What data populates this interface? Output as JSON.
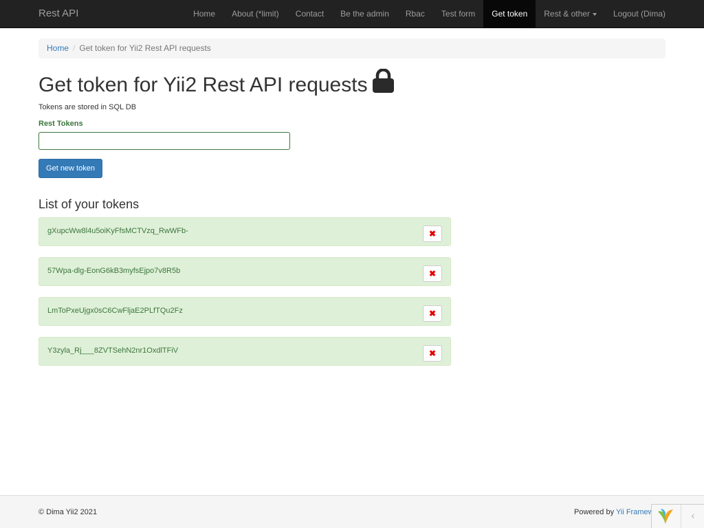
{
  "navbar": {
    "brand": "Rest API",
    "items": [
      {
        "label": "Home"
      },
      {
        "label": "About (*limit)"
      },
      {
        "label": "Contact"
      },
      {
        "label": "Be the admin"
      },
      {
        "label": "Rbac"
      },
      {
        "label": "Test form"
      },
      {
        "label": "Get token",
        "active": true
      },
      {
        "label": "Rest & other",
        "dropdown": true
      },
      {
        "label": "Logout (Dima)"
      }
    ]
  },
  "breadcrumb": {
    "home": "Home",
    "separator": "/",
    "current": "Get token for Yii2 Rest API requests"
  },
  "page": {
    "title": "Get token for Yii2 Rest API requests",
    "icon": "lock-icon",
    "subtitle": "Tokens are stored in SQL DB",
    "field_label": "Rest Tokens",
    "field_value": "",
    "button_label": "Get new token",
    "list_title": "List of your tokens"
  },
  "tokens": [
    {
      "value": "gXupcWw8l4u5oiKyFfsMCTVzq_RwWFb-",
      "delete_icon": "✖"
    },
    {
      "value": "57Wpa-dlg-EonG6kB3myfsEjpo7v8R5b",
      "delete_icon": "✖"
    },
    {
      "value": "LmToPxeUjgx0sC6CwFljaE2PLfTQu2Fz",
      "delete_icon": "✖"
    },
    {
      "value": "Y3zyla_Rj___8ZVTSehN2nr1OxdlTFiV",
      "delete_icon": "✖"
    }
  ],
  "footer": {
    "copyright": "© Dima Yii2 2021",
    "powered_prefix": "Powered by",
    "powered_link": "Yii Framew",
    "debug_toggle": "‹"
  },
  "colors": {
    "navbar_bg": "#222222",
    "active_nav_bg": "#080808",
    "primary": "#337ab7",
    "success_bg": "#dff0d8",
    "success_text": "#3c763d",
    "delete_icon": "#e30000"
  }
}
